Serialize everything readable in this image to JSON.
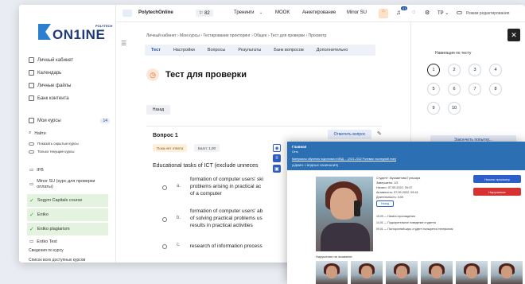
{
  "logo": {
    "text": "ON1INE",
    "sub": "POLYTECH"
  },
  "sidebar": {
    "items": [
      "Личный кабинет",
      "Календарь",
      "Личные файлы",
      "Банк контента"
    ],
    "my_courses": "Мои курсы",
    "my_courses_badge": "14",
    "search": "Найти",
    "show_hidden": "Показать скрытые курсы",
    "only_current": "Только текущие курсы",
    "courses": [
      {
        "label": "IFB",
        "green": false
      },
      {
        "label": "Minor SU (курс для проверки оплаты)",
        "green": false
      },
      {
        "label": "Sogym Capitals course",
        "green": true
      },
      {
        "label": "Entko",
        "green": true
      },
      {
        "label": "Entko plagiarism",
        "green": true
      },
      {
        "label": "Entko Test",
        "green": false
      }
    ],
    "footer1": "Сведения по курсу",
    "footer2": "Список всех доступных курсов"
  },
  "topbar": {
    "brand": "PolytechOnline",
    "flag_count": "82",
    "menu": [
      "Тренинги",
      "MOOK",
      "Анкетирование",
      "Minor SU"
    ],
    "notif_count": "63",
    "user": "TP",
    "edit_mode": "Режим редактирования"
  },
  "breadcrumbs": "Личный кабинет  ›  Мои курсы  ›  Тестирование прокторинг  ›  Общее  ›  Тест для проверки  ›  Просмотр",
  "tabs": [
    "Тест",
    "Настройки",
    "Вопросы",
    "Результаты",
    "Банк вопросов",
    "Дополнительно"
  ],
  "page_title": "Тест для проверки",
  "back_button": "Назад",
  "question": {
    "title": "Вопрос 1",
    "status": "Пока нет ответа",
    "score": "Балл: 1,00",
    "flag_button": "Отметить вопрос",
    "text": "Educational tasks of ICT (exclude unneces",
    "options": [
      {
        "letter": "a.",
        "lines": [
          "formation of computer users' ski",
          "problems arising in practical ac",
          "of a computer"
        ]
      },
      {
        "letter": "b.",
        "lines": [
          "formation of computer users' ab",
          "of solving practical problems us",
          "results in practical activities"
        ]
      },
      {
        "letter": "c.",
        "lines": [
          "research of information process"
        ]
      }
    ]
  },
  "nav_panel": {
    "title": "Навигация по тесту",
    "numbers": [
      "1",
      "2",
      "3",
      "4",
      "5",
      "6",
      "7",
      "8",
      "9",
      "10"
    ],
    "finish": "Закончить попытку..."
  },
  "proctor": {
    "header1": "Главная",
    "header2": "Сеть",
    "header3": "Материалы обучения подготовки в МВД ... (2021-2022 Ролевая: последний этап)",
    "header4": "(АДМИН: 1 ВОДНЫХ НАЧИНАНИЯ)",
    "info": [
      "Студент: Мухаметова Гульсара",
      "Завершено: 1/3",
      "Начато: 07.09.2022, 09:37",
      "Активность: 07.09.2022, 09:41",
      "Длительность: 4:00"
    ],
    "btn_primary": "Начать просмотр",
    "btn_danger": "Нарушение",
    "back_chip": "Назад",
    "events": [
      "15.09  —  Начало прохождения",
      "14.01  —  Подозрительное поведение студента",
      "09.01  —  Посторонний шум, студент пользуется телефоном"
    ],
    "violations_title": "Нарушения на экзамене:"
  }
}
